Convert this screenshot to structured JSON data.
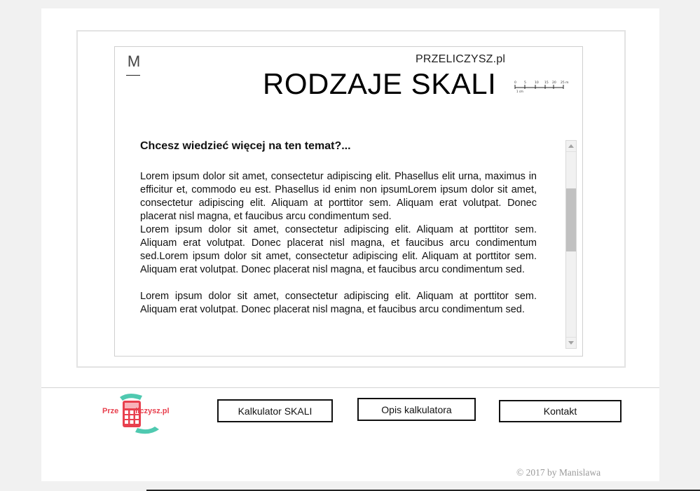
{
  "header": {
    "menu_letter": "M",
    "brand": "PRZELICZYSZ.pl",
    "title": "RODZAJE SKALI"
  },
  "scale_graphic": {
    "ticks": [
      "0",
      "5",
      "10",
      "15",
      "20",
      "25 m"
    ],
    "unit_label": "1 cm"
  },
  "article": {
    "heading": "Chcesz wiedzieć więcej na ten temat?...",
    "paragraph1": "Lorem ipsum dolor sit amet, consectetur adipiscing elit. Phasellus elit urna, maximus in efficitur et, commodo eu est. Phasellus id enim non ipsumLorem ipsum dolor sit amet, consectetur adipiscing elit. Aliquam at porttitor sem.  Aliquam erat volutpat. Donec placerat nisl magna, et faucibus arcu condimentum sed.",
    "paragraph2": "Lorem ipsum dolor sit amet, consectetur adipiscing elit. Aliquam at porttitor sem.  Aliquam erat volutpat. Donec placerat nisl magna, et faucibus arcu condimentum sed.Lorem ipsum dolor sit amet, consectetur adipiscing elit. Aliquam at porttitor sem.  Aliquam erat volutpat. Donec placerat nisl magna, et faucibus arcu condimentum sed.",
    "paragraph3": "Lorem ipsum dolor sit amet, consectetur adipiscing elit. Aliquam at porttitor sem.  Aliquam erat volutpat. Donec placerat nisl magna, et faucibus arcu condimentum sed."
  },
  "footer": {
    "logo_text_part1": "Prze",
    "logo_text_part2": "liczysz.pl",
    "nav": {
      "calculator": "Kalkulator SKALI",
      "description": "Opis kalkulatora",
      "contact": "Kontakt"
    },
    "copyright": "© 2017 by Manislawa"
  },
  "colors": {
    "logo_red": "#e8404e",
    "logo_teal": "#4fc9b0",
    "scroll_thumb": "#c1c1c1"
  }
}
